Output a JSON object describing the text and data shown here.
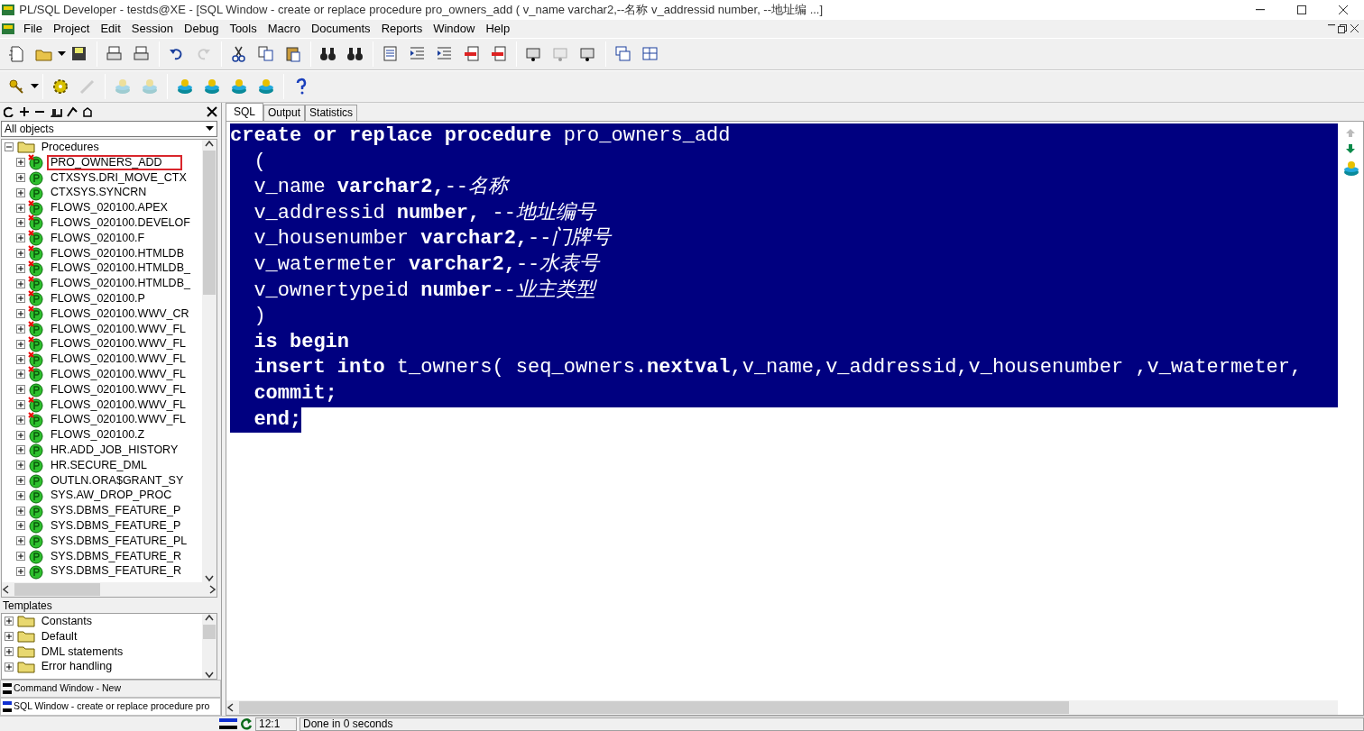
{
  "window": {
    "title": "PL/SQL Developer - testds@XE - [SQL Window - create or replace procedure pro_owners_add ( v_name varchar2,--名称 v_addressid number, --地址编 ...]"
  },
  "menu": [
    "File",
    "Project",
    "Edit",
    "Session",
    "Debug",
    "Tools",
    "Macro",
    "Documents",
    "Reports",
    "Window",
    "Help"
  ],
  "toolbar_1": [
    {
      "disabled": false
    },
    {
      "disabled": false
    },
    {
      "disabled": false
    },
    {
      "disabled": false
    },
    {
      "disabled": false
    },
    {
      "disabled": false
    },
    {
      "disabled": true
    },
    {
      "disabled": false
    },
    {
      "disabled": false
    },
    {
      "disabled": false
    },
    {
      "disabled": false
    },
    {
      "disabled": false
    },
    {
      "disabled": false
    },
    {
      "disabled": false
    },
    {
      "disabled": false
    },
    {
      "disabled": false
    },
    {
      "disabled": false
    },
    {
      "disabled": false
    },
    {
      "disabled": true
    },
    {
      "disabled": false
    },
    {
      "disabled": false
    },
    {
      "disabled": false
    }
  ],
  "toolbar_2": [
    {
      "disabled": false
    },
    {
      "disabled": false
    },
    {
      "disabled": true
    },
    {
      "disabled": true
    },
    {
      "disabled": true
    },
    {
      "disabled": false
    },
    {
      "disabled": false
    },
    {
      "disabled": false
    },
    {
      "disabled": false
    },
    {
      "disabled": false
    }
  ],
  "browser": {
    "filter": "All objects",
    "folder": {
      "label": "Procedures",
      "expanded": true,
      "children": [
        {
          "label": "PRO_OWNERS_ADD",
          "invalid": true,
          "highlighted": true
        },
        {
          "label": "CTXSYS.DRI_MOVE_CTX",
          "invalid": false,
          "highlighted": false
        },
        {
          "label": "CTXSYS.SYNCRN",
          "invalid": false,
          "highlighted": false
        },
        {
          "label": "FLOWS_020100.APEX",
          "invalid": true,
          "highlighted": false
        },
        {
          "label": "FLOWS_020100.DEVELOF",
          "invalid": true,
          "highlighted": false
        },
        {
          "label": "FLOWS_020100.F",
          "invalid": true,
          "highlighted": false
        },
        {
          "label": "FLOWS_020100.HTMLDB",
          "invalid": true,
          "highlighted": false
        },
        {
          "label": "FLOWS_020100.HTMLDB_",
          "invalid": true,
          "highlighted": false
        },
        {
          "label": "FLOWS_020100.HTMLDB_",
          "invalid": true,
          "highlighted": false
        },
        {
          "label": "FLOWS_020100.P",
          "invalid": true,
          "highlighted": false
        },
        {
          "label": "FLOWS_020100.WWV_CR",
          "invalid": true,
          "highlighted": false
        },
        {
          "label": "FLOWS_020100.WWV_FL",
          "invalid": true,
          "highlighted": false
        },
        {
          "label": "FLOWS_020100.WWV_FL",
          "invalid": true,
          "highlighted": false
        },
        {
          "label": "FLOWS_020100.WWV_FL",
          "invalid": true,
          "highlighted": false
        },
        {
          "label": "FLOWS_020100.WWV_FL",
          "invalid": true,
          "highlighted": false
        },
        {
          "label": "FLOWS_020100.WWV_FL",
          "invalid": false,
          "highlighted": false
        },
        {
          "label": "FLOWS_020100.WWV_FL",
          "invalid": true,
          "highlighted": false
        },
        {
          "label": "FLOWS_020100.WWV_FL",
          "invalid": true,
          "highlighted": false
        },
        {
          "label": "FLOWS_020100.Z",
          "invalid": false,
          "highlighted": false
        },
        {
          "label": "HR.ADD_JOB_HISTORY",
          "invalid": false,
          "highlighted": false
        },
        {
          "label": "HR.SECURE_DML",
          "invalid": false,
          "highlighted": false
        },
        {
          "label": "OUTLN.ORA$GRANT_SY",
          "invalid": false,
          "highlighted": false
        },
        {
          "label": "SYS.AW_DROP_PROC",
          "invalid": false,
          "highlighted": false
        },
        {
          "label": "SYS.DBMS_FEATURE_P",
          "invalid": false,
          "highlighted": false
        },
        {
          "label": "SYS.DBMS_FEATURE_P",
          "invalid": false,
          "highlighted": false
        },
        {
          "label": "SYS.DBMS_FEATURE_PL",
          "invalid": false,
          "highlighted": false
        },
        {
          "label": "SYS.DBMS_FEATURE_R",
          "invalid": false,
          "highlighted": false
        },
        {
          "label": "SYS.DBMS_FEATURE_R",
          "invalid": false,
          "highlighted": false
        }
      ]
    }
  },
  "templates": {
    "title": "Templates",
    "items": [
      "Constants",
      "Default",
      "DML statements",
      "Error handling"
    ]
  },
  "windows": [
    {
      "label": "Command Window - New",
      "selected": false
    },
    {
      "label": "SQL Window - create or replace procedure pro",
      "selected": true
    }
  ],
  "tabs": [
    {
      "label": "SQL",
      "selected": true
    },
    {
      "label": "Output",
      "selected": false
    },
    {
      "label": "Statistics",
      "selected": false
    }
  ],
  "editor": {
    "lines": [
      {
        "text": "**create or replace procedure** pro_owners_add",
        "selected": true
      },
      {
        "text": "  (",
        "selected": true
      },
      {
        "text": "  v_name **varchar2,**--*名称*",
        "selected": true
      },
      {
        "text": "  v_addressid **number,** --*地址编号*",
        "selected": true
      },
      {
        "text": "  v_housenumber **varchar2,**--*门牌号*",
        "selected": true
      },
      {
        "text": "  v_watermeter **varchar2,**--*水表号*",
        "selected": true
      },
      {
        "text": "  v_ownertypeid **number**--*业主类型*",
        "selected": true
      },
      {
        "text": "  )",
        "selected": true
      },
      {
        "text": "  **is begin**",
        "selected": true
      },
      {
        "text": "  **insert into** t_owners( seq_owners.**nextval**,v_name,v_addressid,v_housenumber ,v_watermeter,",
        "selected": true
      },
      {
        "text": "  **commit;**",
        "selected": true
      },
      {
        "text": "  **end;**",
        "selected": true
      }
    ]
  },
  "status_bar": {
    "position": "12:1",
    "message": "Done in 0 seconds"
  }
}
